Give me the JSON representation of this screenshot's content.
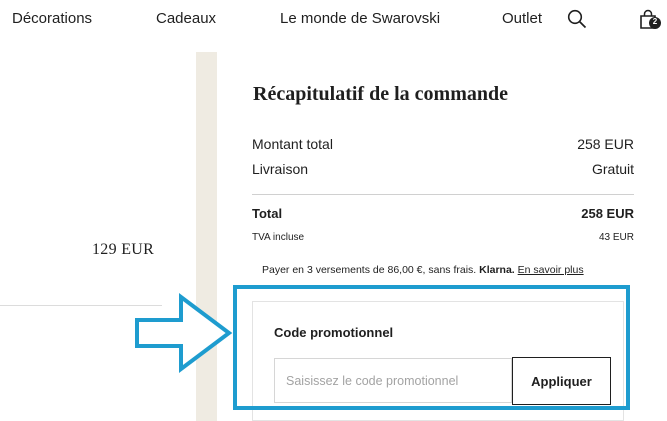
{
  "nav": {
    "items": [
      "Décorations",
      "Cadeaux",
      "Le monde de Swarovski",
      "Outlet"
    ],
    "search_icon": "search-icon",
    "cart_icon": "shopping-bag-icon",
    "cart_count": "2"
  },
  "left": {
    "price": "129 EUR"
  },
  "summary": {
    "title": "Récapitulatif de la commande",
    "subtotal_label": "Montant total",
    "subtotal_value": "258 EUR",
    "shipping_label": "Livraison",
    "shipping_value": "Gratuit",
    "total_label": "Total",
    "total_value": "258 EUR",
    "vat_label": "TVA incluse",
    "vat_value": "43 EUR",
    "klarna_text": "Payer en 3 versements de 86,00 €, sans frais.",
    "klarna_brand": "Klarna.",
    "klarna_link": "En savoir plus"
  },
  "promo": {
    "title": "Code promotionnel",
    "placeholder": "Saisissez le code promotionnel",
    "value": "",
    "button_label": "Appliquer"
  },
  "annotation": {
    "color": "#1e9ccf"
  }
}
